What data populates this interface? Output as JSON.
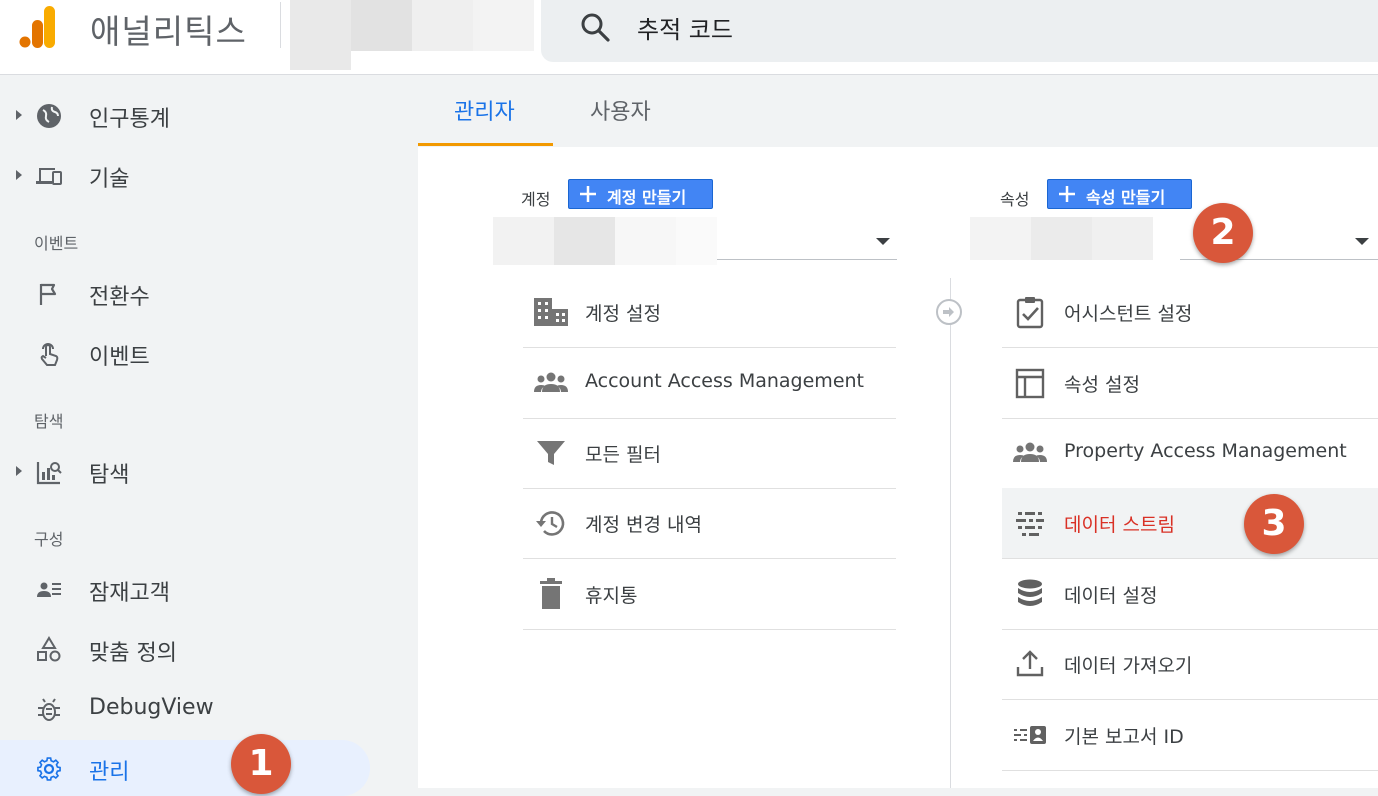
{
  "header": {
    "app_title": "애널리틱스",
    "search_text": "추적 코드"
  },
  "sidebar": {
    "items": [
      {
        "label": "인구통계",
        "icon": "globe-icon",
        "expandable": true
      },
      {
        "label": "기술",
        "icon": "devices-icon",
        "expandable": true
      }
    ],
    "section_events": "이벤트",
    "events_items": [
      {
        "label": "전환수",
        "icon": "flag-icon"
      },
      {
        "label": "이벤트",
        "icon": "touch-icon"
      }
    ],
    "section_explore": "탐색",
    "explore_items": [
      {
        "label": "탐색",
        "icon": "explore-icon",
        "expandable": true
      }
    ],
    "section_config": "구성",
    "config_items": [
      {
        "label": "잠재고객",
        "icon": "audience-icon"
      },
      {
        "label": "맞춤 정의",
        "icon": "shapes-icon"
      },
      {
        "label": "DebugView",
        "icon": "bug-icon"
      },
      {
        "label": "관리",
        "icon": "gear-icon",
        "active": true
      }
    ]
  },
  "tabs": [
    {
      "label": "관리자",
      "active": true
    },
    {
      "label": "사용자",
      "active": false
    }
  ],
  "account_column": {
    "label": "계정",
    "create_button": "계정 만들기",
    "items": [
      {
        "label": "계정 설정",
        "icon": "building-icon"
      },
      {
        "label": "Account Access Management",
        "icon": "people-icon"
      },
      {
        "label": "모든 필터",
        "icon": "filter-icon"
      },
      {
        "label": "계정 변경 내역",
        "icon": "history-icon"
      },
      {
        "label": "휴지통",
        "icon": "trash-icon"
      }
    ]
  },
  "property_column": {
    "label": "속성",
    "create_button": "속성 만들기",
    "items": [
      {
        "label": "어시스턴트 설정",
        "icon": "checklist-icon"
      },
      {
        "label": "속성 설정",
        "icon": "layout-icon"
      },
      {
        "label": "Property Access Management",
        "icon": "people-icon"
      },
      {
        "label": "데이터 스트림",
        "icon": "streams-icon",
        "highlighted": true
      },
      {
        "label": "데이터 설정",
        "icon": "database-icon"
      },
      {
        "label": "데이터 가져오기",
        "icon": "upload-icon"
      },
      {
        "label": "기본 보고서 ID",
        "icon": "id-icon"
      }
    ]
  },
  "badges": {
    "one": "1",
    "two": "2",
    "three": "3"
  },
  "colors": {
    "accent": "#1a73e8",
    "tab_underline": "#f29900",
    "badge": "#d9573a",
    "highlight_text": "#d93025"
  }
}
